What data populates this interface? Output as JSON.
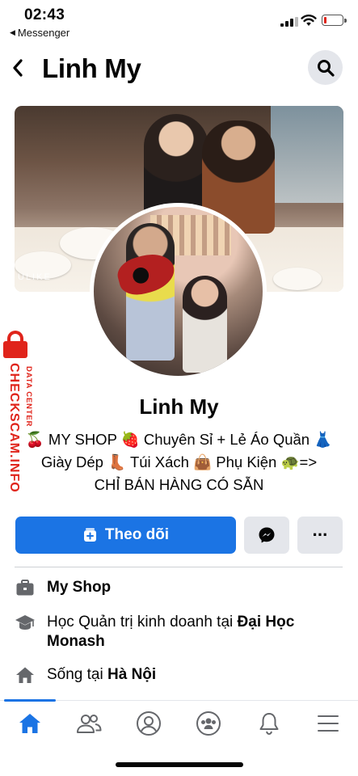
{
  "status": {
    "time": "02:43",
    "back_app": "Messenger",
    "back_glyph": "◀"
  },
  "header": {
    "title": "Linh My"
  },
  "profile": {
    "name": "Linh My",
    "cover_watermark": "ULIKE",
    "bio_line1": "🍒 MY SHOP 🍓 Chuyên Sỉ + Lẻ Áo Quần 👗",
    "bio_line2": "Giày Dép 👢 Túi Xách 👜 Phụ Kiện 🐢=>",
    "bio_line3": "CHỈ BÁN HÀNG CÓ SẴN"
  },
  "actions": {
    "follow_label": "Theo dõi",
    "more_label": "···"
  },
  "details": [
    {
      "text": "My Shop"
    },
    {
      "prefix": "Học Quản trị kinh doanh tại ",
      "bold": "Đại Học Monash"
    },
    {
      "prefix": "Sống tại ",
      "bold": "Hà Nội"
    }
  ],
  "badge": {
    "main": "CHECKSCAM.INFO",
    "sub": "DATA CENTER",
    "color": "#e0241b"
  },
  "colors": {
    "accent": "#1b74e4",
    "button_gray": "#e4e6eb"
  },
  "nav": {
    "items": [
      "home-icon",
      "friends-icon",
      "profile-icon",
      "groups-icon",
      "notifications-icon",
      "menu-icon"
    ],
    "active": "home-icon"
  },
  "battery_level": 0.15
}
